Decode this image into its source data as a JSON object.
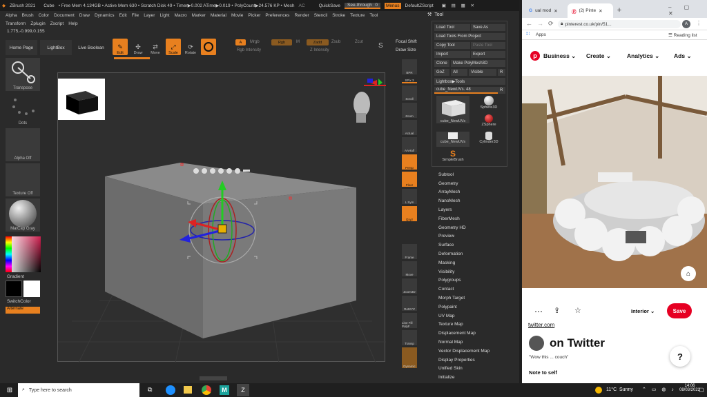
{
  "zbrush": {
    "app_title": "ZBrush 2021",
    "doc": "Cube",
    "mem": "• Free Mem 4.134GB • Active Mem 630 • Scratch Disk 49 • Timer▶0.002 ATime▶0.019 • PolyCount▶24.576 KP • Mesh",
    "ac": "AC",
    "quicksave": "QuickSave",
    "see_through": "See-through",
    "see_through_val": "0",
    "menus_btn": "Menus",
    "default_script": "DefaultZScript",
    "menu_row1": [
      "Alpha",
      "Brush",
      "Color",
      "Document",
      "Draw",
      "Dynamics",
      "Edit",
      "File",
      "Layer",
      "Light",
      "Macro",
      "Marker",
      "Material",
      "Movie",
      "Picker",
      "Preferences",
      "Render",
      "Stencil",
      "Stroke",
      "Texture",
      "Tool"
    ],
    "menu_row2": [
      "Transform",
      "Zplugin",
      "Zscript",
      "Help"
    ],
    "coords": "1.775,-0.999,0.155",
    "home_page": "Home Page",
    "lightbox": "LightBox",
    "live_boolean": "Live Boolean",
    "edit": "Edit",
    "draw": "Draw",
    "move": "Move",
    "scale": "Scale",
    "rotate": "Rotate",
    "a": "A",
    "mrgb": "Mrgb",
    "rgb": "Rgb",
    "m": "M",
    "zadd": "Zadd",
    "zsub": "Zsub",
    "zcut": "Zcut",
    "rgb_intensity": "Rgb Intensity",
    "z_intensity": "Z Intensity",
    "focal_shift": "Focal Shift",
    "draw_size": "Draw Size",
    "left_tiles": [
      "Transpose",
      "Dots",
      "Alpha Off",
      "Texture Off",
      "MatCap Gray"
    ],
    "gradient": "Gradient",
    "switch_color": "SwitchColor",
    "alternate": "Alternate",
    "right_shelf": [
      "BPR",
      "SPix 3",
      "Scroll",
      "Zoom",
      "Actual",
      "AAHalf",
      "Persp",
      "Floor",
      "L.Sym",
      "Qxyz",
      "",
      "",
      "Frame",
      "Move",
      "Zoom3D",
      "RotXYZ",
      "Line Fill PolyF",
      "Transp",
      "Dynamic"
    ],
    "tool_title": "Tool",
    "tool_btns": [
      "Load Tool",
      "Save As",
      "Load Tools From Project",
      "Copy Tool",
      "Paste Tool",
      "Import",
      "Export",
      "Clone",
      "Make PolyMesh3D",
      "GoZ",
      "All",
      "Visible",
      "R"
    ],
    "lightbox_tools": "Lightbox▶Tools",
    "current_tool": "cube_NewUVs.",
    "current_tool_val": "48",
    "r": "R",
    "thumbs": [
      "cube_NewUVs",
      "Sphere3D",
      "ZSphere",
      "cube_NewUVs",
      "Cylinder3D",
      "SimpleBrush"
    ],
    "tool_list": [
      "Subtool",
      "Geometry",
      "ArrayMesh",
      "NanoMesh",
      "Layers",
      "FiberMesh",
      "Geometry HD",
      "Preview",
      "Surface",
      "Deformation",
      "Masking",
      "Visibility",
      "Polygroups",
      "Contact",
      "Morph Target",
      "Polypaint",
      "UV Map",
      "Texture Map",
      "Displacement Map",
      "Normal Map",
      "Vector Displacement Map",
      "Display Properties",
      "Unified Skin",
      "Initialize"
    ]
  },
  "chrome": {
    "tab1": "ual mod",
    "tab2": "(2) Pinte",
    "url": "pinterest.co.uk/pin/51...",
    "apps": "Apps",
    "reading_list": "Reading list",
    "avatar": "A",
    "nav": [
      "Business",
      "Create",
      "Analytics",
      "Ads"
    ],
    "board": "Interior",
    "save": "Save",
    "source": "twitter.com",
    "title": "on Twitter",
    "desc": "\"Wow this ... couch\"",
    "note": "Note to self",
    "help": "?"
  },
  "taskbar": {
    "search": "Type here to search",
    "temp": "11°C",
    "weather": "Sunny",
    "time": "14:06",
    "date": "08/03/2022"
  },
  "colors": {
    "accent": "#e8801f",
    "pin_red": "#e60023"
  }
}
